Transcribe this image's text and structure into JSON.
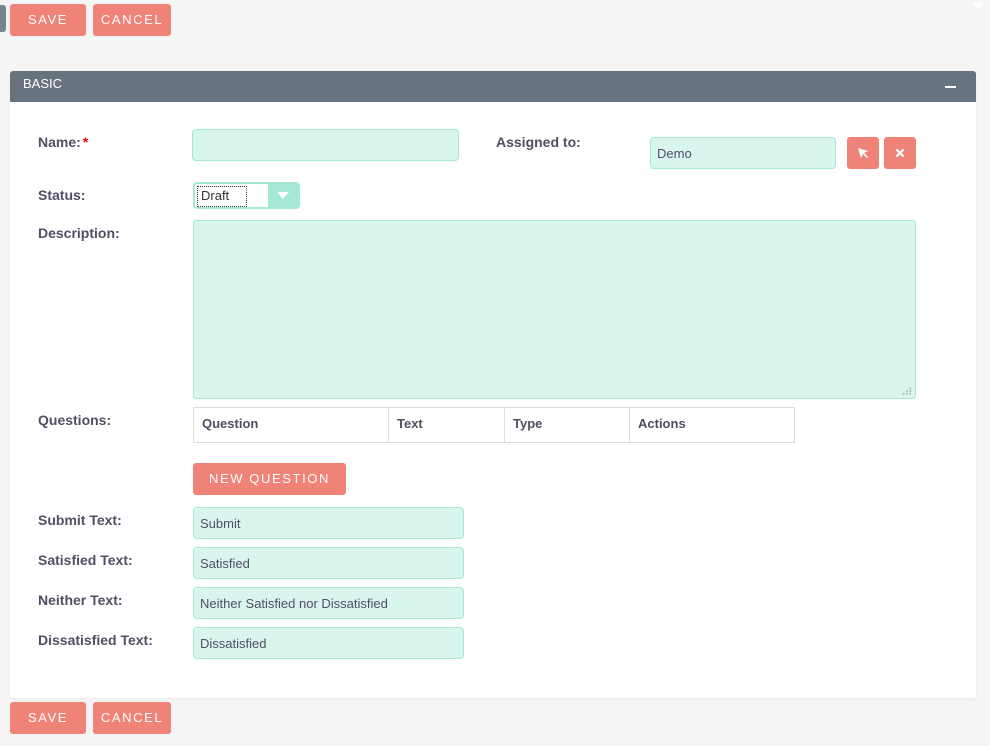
{
  "top_actions": {
    "save_label": "SAVE",
    "cancel_label": "CANCEL"
  },
  "panel": {
    "title": "BASIC",
    "collapse_icon": "minus-icon"
  },
  "form": {
    "name": {
      "label": "Name:",
      "required_mark": "*",
      "value": ""
    },
    "assigned_to": {
      "label": "Assigned to:",
      "value": "Demo",
      "select_icon": "cursor-arrow-icon",
      "clear_icon": "close-icon"
    },
    "status": {
      "label": "Status:",
      "selected": "Draft"
    },
    "description": {
      "label": "Description:",
      "value": ""
    },
    "questions": {
      "label": "Questions:",
      "columns": [
        "Question",
        "Text",
        "Type",
        "Actions"
      ],
      "rows": [],
      "new_question_label": "NEW QUESTION"
    },
    "submit_text": {
      "label": "Submit Text:",
      "value": "Submit"
    },
    "satisfied_text": {
      "label": "Satisfied Text:",
      "value": "Satisfied"
    },
    "neither_text": {
      "label": "Neither Text:",
      "value": "Neither Satisfied nor Dissatisfied"
    },
    "dissatisfied_text": {
      "label": "Dissatisfied Text:",
      "value": "Dissatisfied"
    }
  },
  "bottom_actions": {
    "save_label": "SAVE",
    "cancel_label": "CANCEL"
  },
  "colors": {
    "button": "#f08377",
    "panel_header": "#677480",
    "input_bg": "#d8f5ee",
    "input_border": "#a5e8d6",
    "required": "#ff0000"
  }
}
